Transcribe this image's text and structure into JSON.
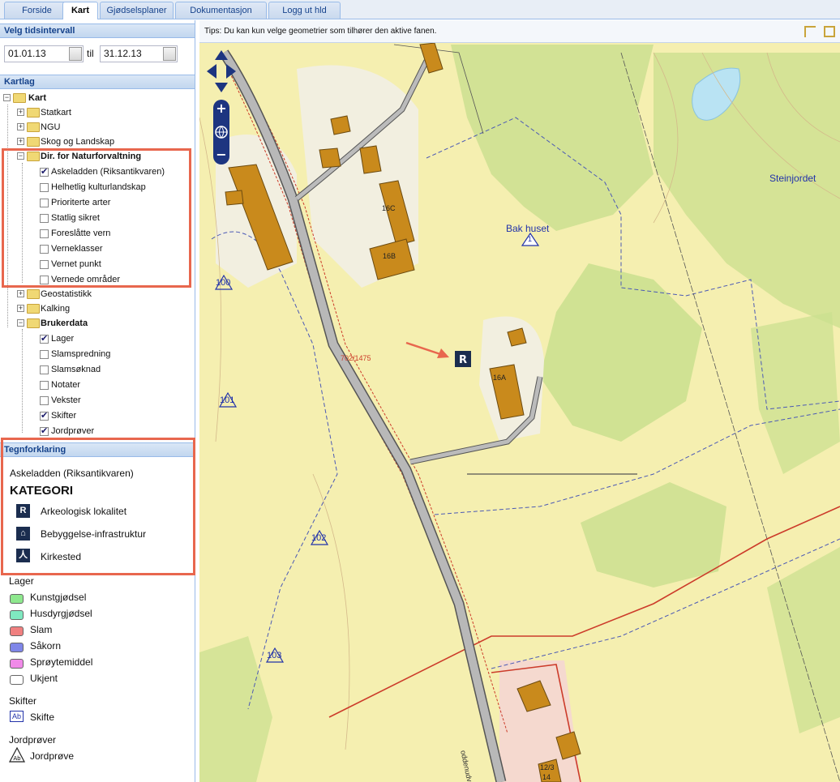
{
  "tabs": [
    {
      "label": "Forside"
    },
    {
      "label": "Kart"
    },
    {
      "label": "Gjødselsplaner"
    },
    {
      "label": "Dokumentasjon"
    },
    {
      "label": "Logg ut hld"
    }
  ],
  "time": {
    "title": "Velg tidsintervall",
    "from": "01.01.13",
    "to_label": "til",
    "to": "31.12.13"
  },
  "layers": {
    "title": "Kartlag",
    "root": "Kart",
    "groups": {
      "statkart": "Statkart",
      "ngu": "NGU",
      "skog": "Skog og Landskap",
      "dirnat": "Dir. for Naturforvaltning",
      "geostat": "Geostatistikk",
      "kalking": "Kalking",
      "bruker": "Brukerdata"
    },
    "dirnat_items": [
      {
        "label": "Askeladden (Riksantikvaren)",
        "checked": true
      },
      {
        "label": "Helhetlig kulturlandskap",
        "checked": false
      },
      {
        "label": "Prioriterte arter",
        "checked": false
      },
      {
        "label": "Statlig sikret",
        "checked": false
      },
      {
        "label": "Foreslåtte vern",
        "checked": false
      },
      {
        "label": "Verneklasser",
        "checked": false
      },
      {
        "label": "Vernet punkt",
        "checked": false
      },
      {
        "label": "Vernede områder",
        "checked": false
      }
    ],
    "bruker_items": [
      {
        "label": "Lager",
        "checked": true
      },
      {
        "label": "Slamspredning",
        "checked": false
      },
      {
        "label": "Slamsøknad",
        "checked": false
      },
      {
        "label": "Notater",
        "checked": false
      },
      {
        "label": "Vekster",
        "checked": false
      },
      {
        "label": "Skifter",
        "checked": true
      },
      {
        "label": "Jordprøver",
        "checked": true
      }
    ]
  },
  "legend": {
    "title": "Tegnforklaring",
    "source": "Askeladden (Riksantikvaren)",
    "category_title": "KATEGORI",
    "categories": [
      {
        "label": "Arkeologisk lokalitet",
        "icon": "r-icon"
      },
      {
        "label": "Bebyggelse-infrastruktur",
        "icon": "house-icon"
      },
      {
        "label": "Kirkested",
        "icon": "person-icon"
      }
    ],
    "lager_title": "Lager",
    "lager": [
      {
        "label": "Kunstgjødsel",
        "color": "#8ee88e"
      },
      {
        "label": "Husdyrgjødsel",
        "color": "#7fe8c0"
      },
      {
        "label": "Slam",
        "color": "#f08080"
      },
      {
        "label": "Såkorn",
        "color": "#7f86e8"
      },
      {
        "label": "Sprøytemiddel",
        "color": "#f08ae8"
      },
      {
        "label": "Ukjent",
        "color": "#ffffff"
      }
    ],
    "skifter_title": "Skifter",
    "skifte_label": "Skifte",
    "jord_title": "Jordprøver",
    "jord_label": "Jordprøve"
  },
  "map": {
    "tip": "Tips: Du kan kun velge geometrier som tilhører den aktive fanen.",
    "labels": {
      "steinjordet": "Steinjordet",
      "bakhuset": "Bak huset",
      "bakhuset_num": "1",
      "b16c": "16C",
      "b16b": "16B",
      "b16a": "16A",
      "p100": "100",
      "p101": "101",
      "p102": "102",
      "p103": "103",
      "road_id": "702/1475",
      "road_name": "oddenudveien",
      "b12": "12/3",
      "b14": "14"
    },
    "colors": {
      "accent": "#e8674e",
      "terrain": "#f5efb0",
      "forest": "#c9df8e"
    }
  }
}
